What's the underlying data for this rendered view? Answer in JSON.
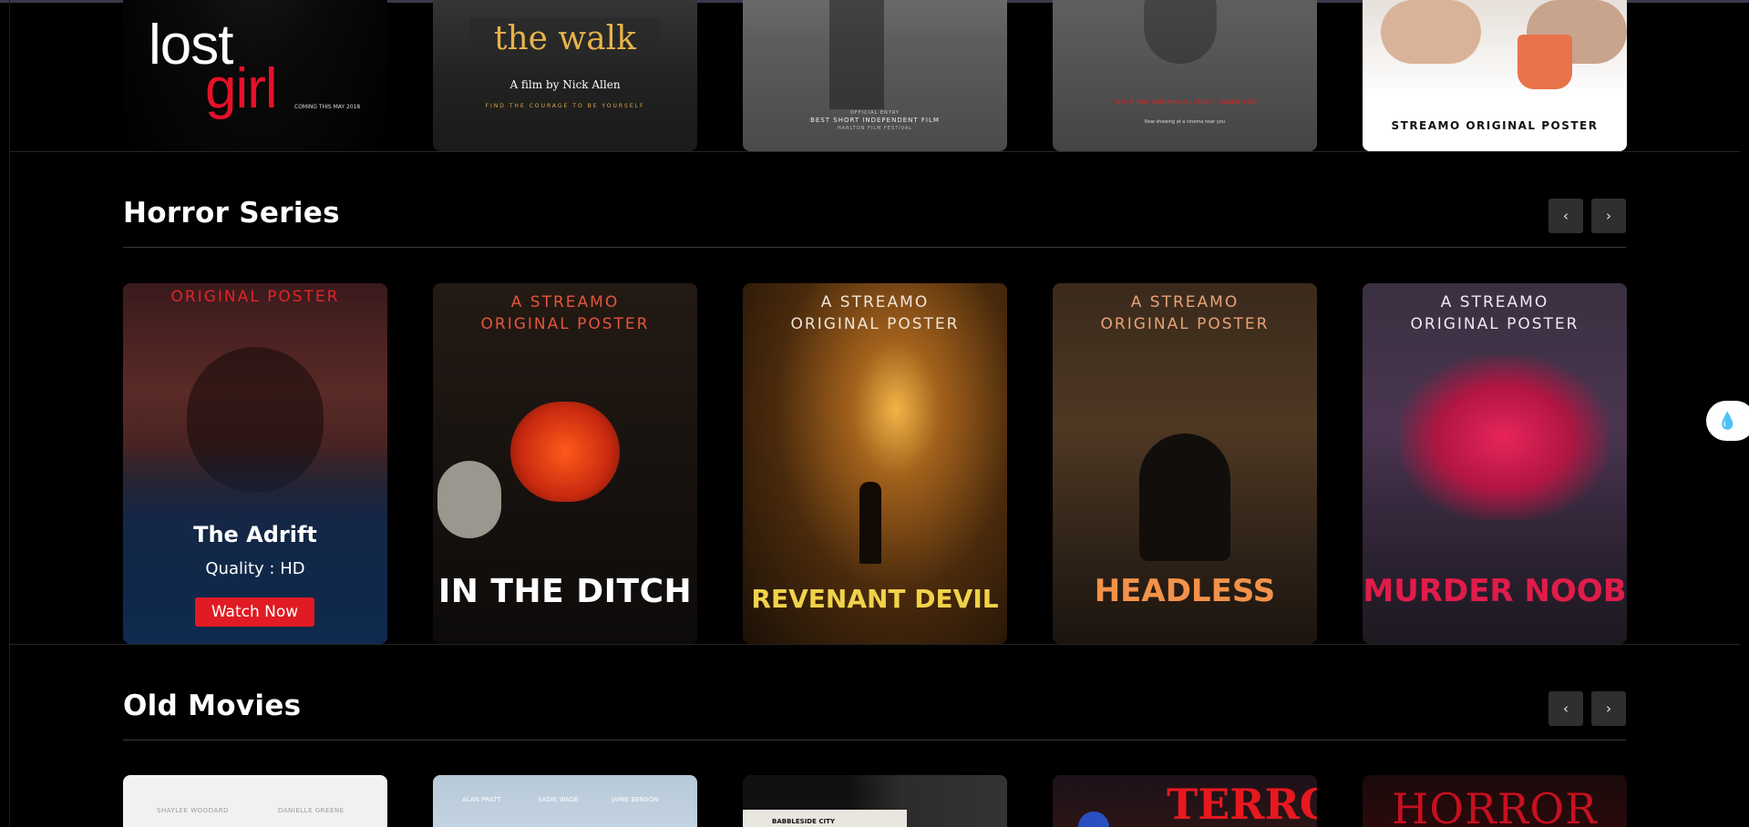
{
  "top_row": {
    "posters": [
      {
        "title_1": "lost",
        "title_2": "girl",
        "tagline": "COMING THIS MAY 2018"
      },
      {
        "title": "the walk",
        "subtitle": "A film by Nick Allen",
        "tagline": "FIND THE COURAGE TO BE YOURSELF"
      },
      {
        "line_1": "OFFICIAL ENTRY",
        "line_2": "BEST SHORT INDEPENDENT FILM",
        "line_3": "HARLTON FILM FESTIVAL"
      },
      {
        "quote": "\"A FILM THAT CONFIRMS ALL FEARS\" - ROGER FLINT",
        "tagline": "Now showing at a cinema near you"
      },
      {
        "label": "STREAMO ORIGINAL POSTER"
      }
    ]
  },
  "horror": {
    "title": "Horror Series",
    "prev_icon": "chevron-left-icon",
    "next_icon": "chevron-right-icon",
    "prev_glyph": "‹",
    "next_glyph": "›",
    "posters": [
      {
        "top": "ORIGINAL POSTER",
        "hover_title": "The Adrift",
        "quality": "Quality : HD",
        "button": "Watch Now"
      },
      {
        "top_1": "A STREAMO",
        "top_2": "ORIGINAL POSTER",
        "title": "IN THE DITCH"
      },
      {
        "top_1": "A STREAMO",
        "top_2": "ORIGINAL POSTER",
        "title": "REVENANT DEVIL"
      },
      {
        "top_1": "A STREAMO",
        "top_2": "ORIGINAL POSTER",
        "title": "HEADLESS"
      },
      {
        "top_1": "A STREAMO",
        "top_2": "ORIGINAL POSTER",
        "title": "MURDER NOOB"
      }
    ]
  },
  "old": {
    "title": "Old Movies",
    "prev_glyph": "‹",
    "next_glyph": "›",
    "posters": [
      {
        "name_1": "SHAYLEE WOODARD",
        "name_2": "DANIELLE GREENE"
      },
      {
        "name_1": "ALAN PRATT",
        "name_2": "SADIE WADE",
        "name_3": "JAMIE BENSON"
      },
      {
        "label": "BABBLESIDE CITY"
      },
      {
        "title": "TERROR"
      },
      {
        "title": "HORROR"
      }
    ]
  },
  "floating": {
    "icon": "droplet-sparkle-icon",
    "glyph": "💧"
  },
  "colors": {
    "accent": "#e01b23",
    "hover_overlay": "#0e2a4e",
    "background": "#000000"
  }
}
